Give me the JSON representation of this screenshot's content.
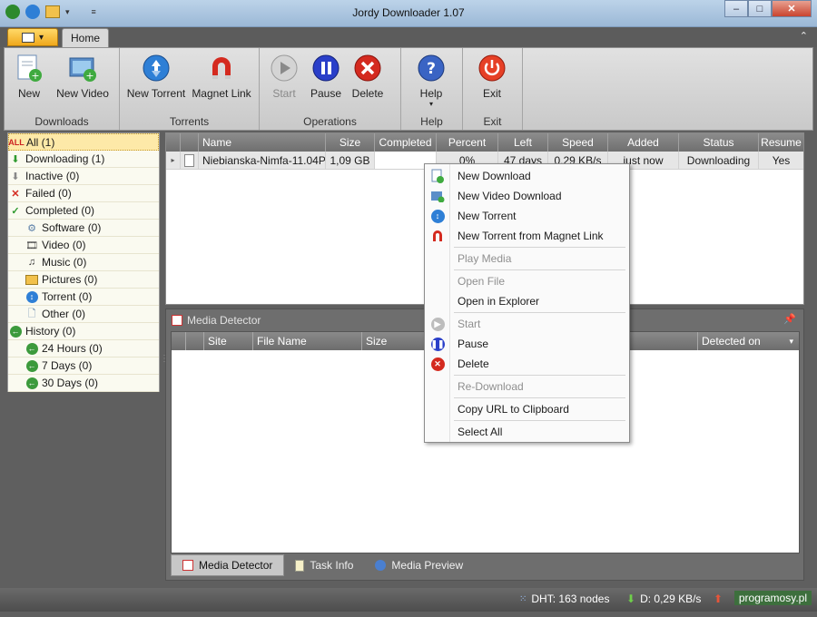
{
  "window": {
    "title": "Jordy Downloader 1.07",
    "minimize": "‒",
    "maximize": "□",
    "close": "✕"
  },
  "tabs": {
    "home": "Home"
  },
  "ribbon": {
    "groups": [
      {
        "label": "Downloads",
        "buttons": [
          "New",
          "New Video"
        ]
      },
      {
        "label": "Torrents",
        "buttons": [
          "New Torrent",
          "Magnet Link"
        ]
      },
      {
        "label": "Operations",
        "buttons": [
          "Start",
          "Pause",
          "Delete"
        ]
      },
      {
        "label": "Help",
        "buttons": [
          "Help"
        ]
      },
      {
        "label": "Exit",
        "buttons": [
          "Exit"
        ]
      }
    ]
  },
  "sidebar": {
    "items": [
      {
        "label": "All (1)"
      },
      {
        "label": "Downloading (1)"
      },
      {
        "label": "Inactive (0)"
      },
      {
        "label": "Failed (0)"
      },
      {
        "label": "Completed (0)"
      },
      {
        "label": "Software (0)"
      },
      {
        "label": "Video (0)"
      },
      {
        "label": "Music (0)"
      },
      {
        "label": "Pictures (0)"
      },
      {
        "label": "Torrent (0)"
      },
      {
        "label": "Other (0)"
      },
      {
        "label": "History (0)"
      },
      {
        "label": "24 Hours (0)"
      },
      {
        "label": "7 Days (0)"
      },
      {
        "label": "30 Days (0)"
      }
    ]
  },
  "downloads": {
    "columns": [
      "Name",
      "Size",
      "Completed",
      "Percent",
      "Left",
      "Speed",
      "Added",
      "Status",
      "Resume"
    ],
    "rows": [
      {
        "name": "Niebianska-Nimfa-11.04P...",
        "size": "1,09 GB",
        "completed": "",
        "percent": "0%",
        "left": "47 days",
        "speed": "0,29 KB/s",
        "added": "just now",
        "status": "Downloading",
        "resume": "Yes"
      }
    ]
  },
  "media_detector": {
    "title": "Media Detector",
    "columns": [
      "Site",
      "File Name",
      "Size",
      "Detected on"
    ],
    "tabs": [
      "Media Detector",
      "Task Info",
      "Media Preview"
    ]
  },
  "context_menu": {
    "items": [
      "New Download",
      "New Video Download",
      "New Torrent",
      "New Torrent from Magnet Link",
      "Play Media",
      "Open File",
      "Open in Explorer",
      "Start",
      "Pause",
      "Delete",
      "Re-Download",
      "Copy URL to Clipboard",
      "Select All"
    ]
  },
  "statusbar": {
    "dht": "DHT: 163 nodes",
    "download": "D: 0,29 KB/s",
    "brand": "programosy.pl"
  },
  "colors": {
    "accent_orange": "#f0a81c",
    "selection": "#fde9a8",
    "torrent_blue": "#2e7fd6",
    "delete_red": "#d42a1f"
  }
}
